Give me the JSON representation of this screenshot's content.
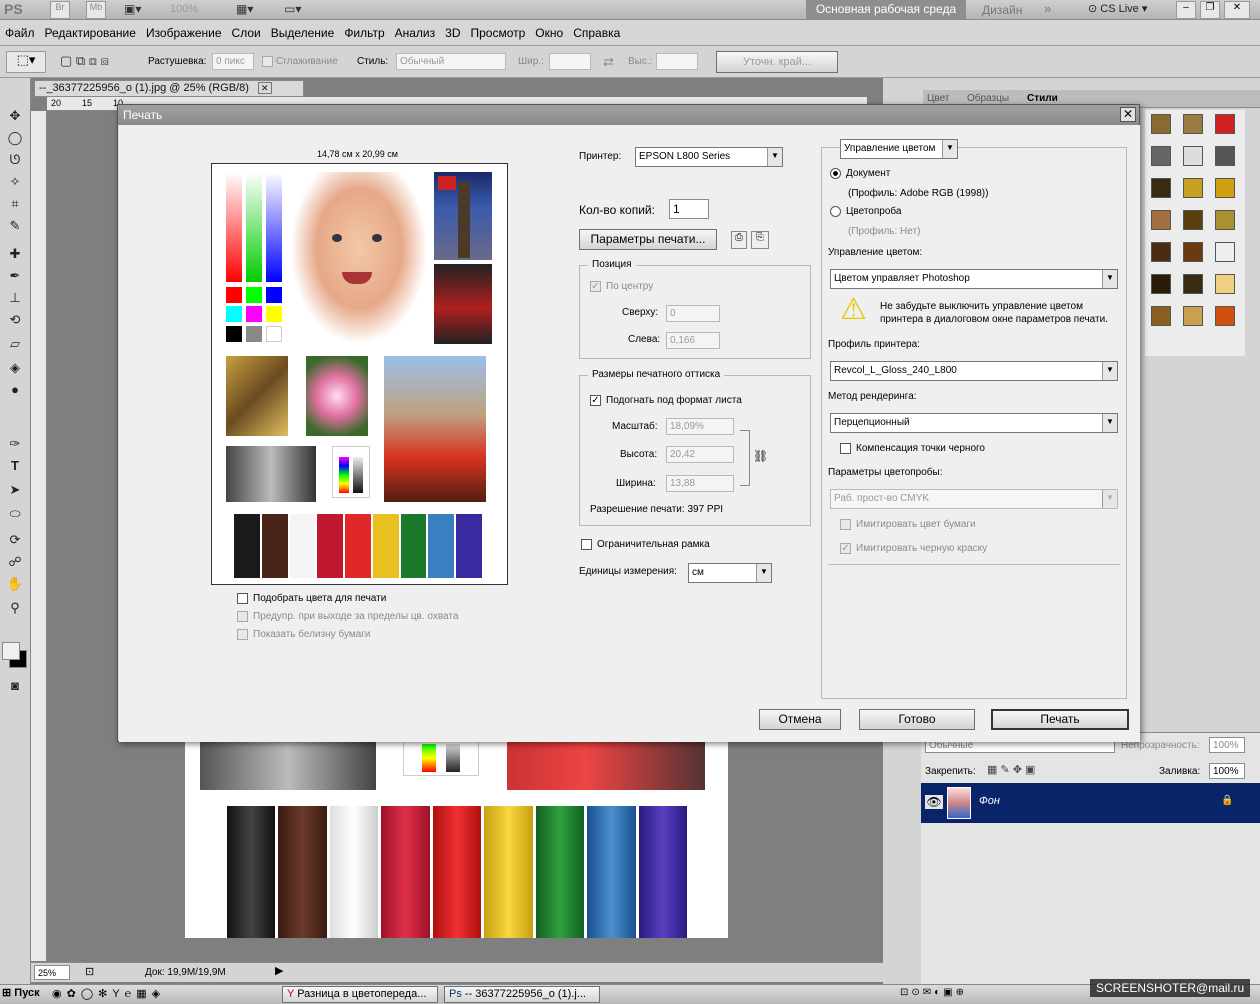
{
  "app": {
    "logo": "PS",
    "minibridge_labels": [
      "Br",
      "Mb"
    ],
    "zoom_combo": "100%",
    "workspace_active": "Основная рабочая среда",
    "workspace_other": "Дизайн",
    "cslive": "CS Live"
  },
  "menu": [
    "Файл",
    "Редактирование",
    "Изображение",
    "Слои",
    "Выделение",
    "Фильтр",
    "Анализ",
    "3D",
    "Просмотр",
    "Окно",
    "Справка"
  ],
  "options": {
    "feather_label": "Растушевка:",
    "feather_value": "0 пикс",
    "antialias_label": "Сглаживание",
    "style_label": "Стиль:",
    "style_value": "Обычный",
    "width_label": "Шир.:",
    "height_label": "Выс.:",
    "refine_button": "Уточн. край..."
  },
  "document": {
    "tab_title": "--_36377225956_o (1).jpg @ 25% (RGB/8)",
    "ruler_marks": [
      "20",
      "15",
      "10"
    ],
    "zoom": "25%",
    "doc_info": "Док: 19,9M/19,9M"
  },
  "panels": {
    "tabs": [
      "Цвет",
      "Образцы",
      "Стили"
    ],
    "blend_mode": "Обычные",
    "opacity_label": "Непрозрачность:",
    "opacity_value": "100%",
    "lock_label": "Закрепить:",
    "fill_label": "Заливка:",
    "fill_value": "100%",
    "layer_name": "Фон"
  },
  "dialog": {
    "title": "Печать",
    "paper_size": "14,78 см x 20,99 см",
    "printer_label": "Принтер:",
    "printer_value": "EPSON L800 Series",
    "copies_label": "Кол-во копий:",
    "copies_value": "1",
    "print_settings_button": "Параметры печати...",
    "position": {
      "title": "Позиция",
      "center_label": "По центру",
      "top_label": "Сверху:",
      "top_value": "0",
      "left_label": "Слева:",
      "left_value": "0,166"
    },
    "size": {
      "title": "Размеры печатного оттиска",
      "fit_label": "Подогнать под формат листа",
      "scale_label": "Масштаб:",
      "scale_value": "18,09%",
      "height_label": "Высота:",
      "height_value": "20,42",
      "width_label": "Ширина:",
      "width_value": "13,88",
      "resolution": "Разрешение печати: 397 PPI"
    },
    "bounding_box_label": "Ограничительная рамка",
    "units_label": "Единицы измерения:",
    "units_value": "см",
    "match_colors_label": "Подобрать цвета для печати",
    "gamut_warning_label": "Предупр. при выходе за пределы цв. охвата",
    "paper_white_label": "Показать белизну бумаги",
    "color_mgmt": {
      "header_select": "Управление цветом",
      "document_label": "Документ",
      "document_profile": "(Профиль: Adobe RGB (1998))",
      "proof_label": "Цветопроба",
      "proof_profile": "(Профиль: Нет)",
      "handling_label": "Управление цветом:",
      "handling_value": "Цветом управляет Photoshop",
      "warning_text_1": "Не забудьте выключить управление цветом",
      "warning_text_2": "принтера в диалоговом окне параметров печати.",
      "printer_profile_label": "Профиль принтера:",
      "printer_profile_value": "Revcol_L_Gloss_240_L800",
      "intent_label": "Метод рендеринга:",
      "intent_value": "Перцепционный",
      "bpc_label": "Компенсация точки черного",
      "proof_setup_label": "Параметры цветопробы:",
      "proof_setup_value": "Раб. прост-во CMYK",
      "sim_paper_label": "Имитировать цвет бумаги",
      "sim_ink_label": "Имитировать черную краску"
    },
    "buttons": {
      "cancel": "Отмена",
      "done": "Готово",
      "print": "Печать"
    }
  },
  "taskbar": {
    "start": "Пуск",
    "item1": "Разница в цветопереда...",
    "item2": "-- 36377225956_o (1).j...",
    "watermark": "SCREENSHOTER@mail.ru"
  }
}
